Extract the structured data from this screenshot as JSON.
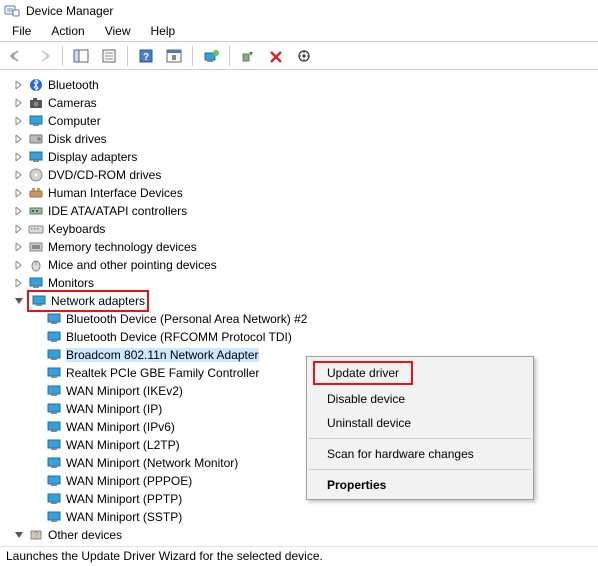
{
  "window": {
    "title": "Device Manager"
  },
  "menu": {
    "file": "File",
    "action": "Action",
    "view": "View",
    "help": "Help"
  },
  "tree": {
    "bluetooth": "Bluetooth",
    "cameras": "Cameras",
    "computer": "Computer",
    "disk_drives": "Disk drives",
    "display_adapters": "Display adapters",
    "dvd": "DVD/CD-ROM drives",
    "hid": "Human Interface Devices",
    "ide": "IDE ATA/ATAPI controllers",
    "keyboards": "Keyboards",
    "memtech": "Memory technology devices",
    "mice": "Mice and other pointing devices",
    "monitors": "Monitors",
    "network_adapters": "Network adapters",
    "net_children": {
      "bt_pan": "Bluetooth Device (Personal Area Network) #2",
      "bt_rfcomm": "Bluetooth Device (RFCOMM Protocol TDI)",
      "broadcom": "Broadcom 802.11n Network Adapter",
      "realtek": "Realtek PCIe GBE Family Controller",
      "wan_ikev2": "WAN Miniport (IKEv2)",
      "wan_ip": "WAN Miniport (IP)",
      "wan_ipv6": "WAN Miniport (IPv6)",
      "wan_l2tp": "WAN Miniport (L2TP)",
      "wan_netmon": "WAN Miniport (Network Monitor)",
      "wan_pppoe": "WAN Miniport (PPPOE)",
      "wan_pptp": "WAN Miniport (PPTP)",
      "wan_sstp": "WAN Miniport (SSTP)"
    },
    "other_devices": "Other devices"
  },
  "contextmenu": {
    "update": "Update driver",
    "disable": "Disable device",
    "uninstall": "Uninstall device",
    "scan": "Scan for hardware changes",
    "properties": "Properties"
  },
  "statusbar": {
    "text": "Launches the Update Driver Wizard for the selected device."
  }
}
